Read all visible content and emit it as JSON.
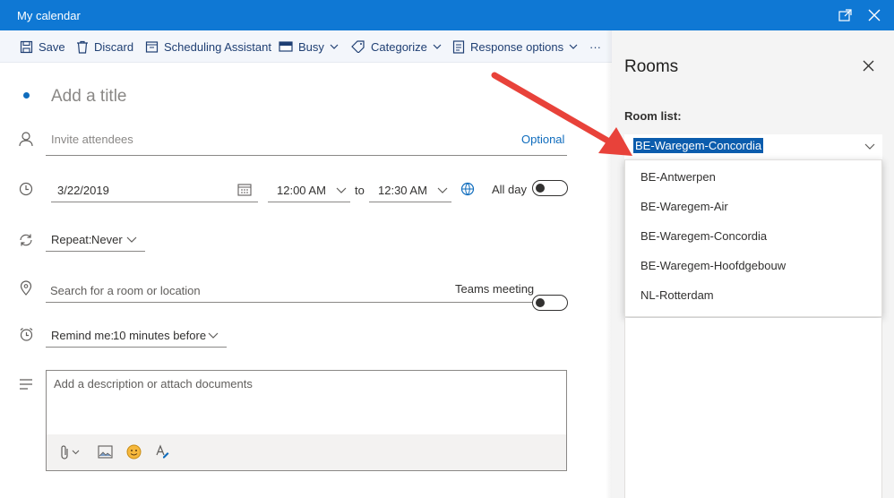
{
  "window": {
    "title": "My calendar"
  },
  "toolbar": {
    "save": "Save",
    "discard": "Discard",
    "scheduling": "Scheduling Assistant",
    "busy": "Busy",
    "categorize": "Categorize",
    "response": "Response options",
    "more": "···"
  },
  "form": {
    "title_placeholder": "Add a title",
    "attendees_placeholder": "Invite attendees",
    "optional": "Optional",
    "date": "3/22/2019",
    "start_time": "12:00 AM",
    "to": "to",
    "end_time": "12:30 AM",
    "all_day": "All day",
    "repeat_label": "Repeat:",
    "repeat_value": "Never",
    "location_placeholder": "Search for a room or location",
    "teams_meeting": "Teams meeting",
    "remind_label": "Remind me:",
    "remind_value": "10 minutes before",
    "description_placeholder": "Add a description or attach documents"
  },
  "rooms_panel": {
    "title": "Rooms",
    "room_list_label": "Room list:",
    "selected": "BE-Waregem-Concordia",
    "options": [
      "BE-Antwerpen",
      "BE-Waregem-Air",
      "BE-Waregem-Concordia",
      "BE-Waregem-Hoofdgebouw",
      "NL-Rotterdam"
    ]
  },
  "colors": {
    "titlebar": "#0f78d4",
    "accent": "#0f6cbd",
    "arrow": "#e8423a",
    "selection": "#0b5cad"
  }
}
